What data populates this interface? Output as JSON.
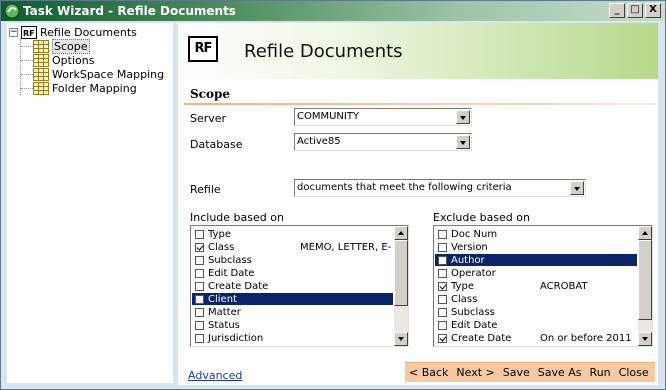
{
  "window": {
    "title": "Task Wizard - Refile Documents",
    "buttons": {
      "minimize": "_",
      "maximize": "□",
      "close": "X"
    }
  },
  "tree": {
    "root": "Refile Documents",
    "items": [
      {
        "label": "Scope",
        "selected": true
      },
      {
        "label": "Options"
      },
      {
        "label": "WorkSpace Mapping"
      },
      {
        "label": "Folder Mapping"
      }
    ]
  },
  "header": {
    "logo": "RF",
    "title": "Refile Documents"
  },
  "scope": {
    "section_title": "Scope",
    "server_label": "Server",
    "server_value": "COMMUNITY",
    "database_label": "Database",
    "database_value": "Active85",
    "refile_label": "Refile",
    "refile_value": "documents that meet the following criteria"
  },
  "include": {
    "label": "Include based on",
    "rows": [
      {
        "label": "Type",
        "checked": false,
        "value": ""
      },
      {
        "label": "Class",
        "checked": true,
        "value": "MEMO, LETTER, E-"
      },
      {
        "label": "Subclass",
        "checked": false,
        "value": ""
      },
      {
        "label": "Edit Date",
        "checked": false,
        "value": ""
      },
      {
        "label": "Create Date",
        "checked": false,
        "value": ""
      },
      {
        "label": "Client",
        "checked": false,
        "value": "",
        "selected": true
      },
      {
        "label": "Matter",
        "checked": false,
        "value": ""
      },
      {
        "label": "Status",
        "checked": false,
        "value": ""
      },
      {
        "label": "Jurisdiction",
        "checked": false,
        "value": ""
      }
    ]
  },
  "exclude": {
    "label": "Exclude based on",
    "rows": [
      {
        "label": "Doc Num",
        "checked": false,
        "value": ""
      },
      {
        "label": "Version",
        "checked": false,
        "value": ""
      },
      {
        "label": "Author",
        "checked": false,
        "value": "",
        "selected": true
      },
      {
        "label": "Operator",
        "checked": false,
        "value": ""
      },
      {
        "label": "Type",
        "checked": true,
        "value": "ACROBAT"
      },
      {
        "label": "Class",
        "checked": false,
        "value": ""
      },
      {
        "label": "Subclass",
        "checked": false,
        "value": ""
      },
      {
        "label": "Edit Date",
        "checked": false,
        "value": ""
      },
      {
        "label": "Create Date",
        "checked": true,
        "value": "On or before 2011"
      }
    ]
  },
  "footer": {
    "advanced_link": "Advanced",
    "buttons": [
      "< Back",
      "Next >",
      "Save",
      "Save As",
      "Run",
      "Close"
    ]
  },
  "colors": {
    "title_bar": "#0f5d2e",
    "header_green": "#b6d98a",
    "selection": "#0a246a",
    "action_bar": "#f7c9a0",
    "link": "#1a3aa0"
  }
}
